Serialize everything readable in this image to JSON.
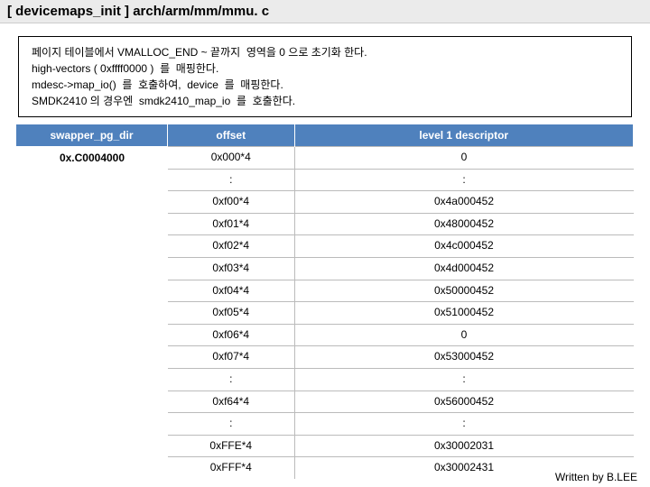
{
  "title": "[ devicemaps_init ] arch/arm/mm/mmu. c",
  "description": {
    "line1": "페이지 테이블에서 VMALLOC_END ~ 끝까지  영역을 0 으로 초기화 한다.",
    "line2": "high-vectors ( 0xffff0000 )  를  매핑한다.",
    "line3": "mdesc->map_io()  를  호출하여,  device  를  매핑한다.",
    "line4": "SMDK2410 의 경우엔  smdk2410_map_io  를  호출한다."
  },
  "left": {
    "header": "swapper_pg_dir",
    "label": "0x.C0004000"
  },
  "table": {
    "headers": {
      "offset": "offset",
      "desc": "level 1 descriptor"
    },
    "rows": [
      {
        "offset": "0x000*4",
        "desc": "0"
      },
      {
        "offset": ":",
        "desc": ":"
      },
      {
        "offset": "0xf00*4",
        "desc": "0x4a000452"
      },
      {
        "offset": "0xf01*4",
        "desc": "0x48000452"
      },
      {
        "offset": "0xf02*4",
        "desc": "0x4c000452"
      },
      {
        "offset": "0xf03*4",
        "desc": "0x4d000452"
      },
      {
        "offset": "0xf04*4",
        "desc": "0x50000452"
      },
      {
        "offset": "0xf05*4",
        "desc": "0x51000452"
      },
      {
        "offset": "0xf06*4",
        "desc": "0"
      },
      {
        "offset": "0xf07*4",
        "desc": "0x53000452"
      },
      {
        "offset": ":",
        "desc": ":"
      },
      {
        "offset": "0xf64*4",
        "desc": "0x56000452"
      },
      {
        "offset": ":",
        "desc": ":"
      },
      {
        "offset": "0xFFE*4",
        "desc": "0x30002031"
      },
      {
        "offset": "0xFFF*4",
        "desc": "0x30002431"
      }
    ]
  },
  "footer": "Written by B.LEE"
}
